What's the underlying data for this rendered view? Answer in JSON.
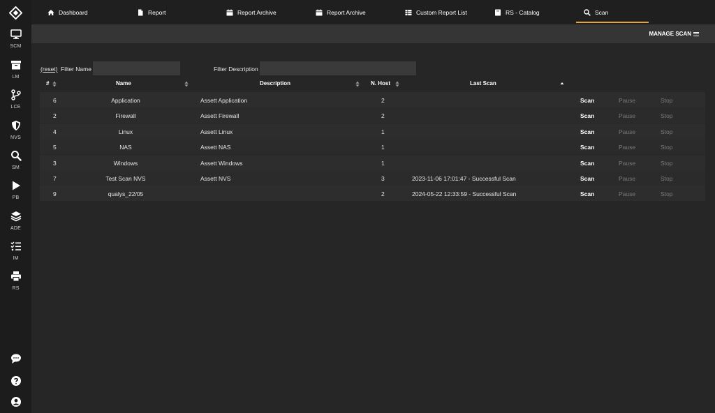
{
  "sidebar": {
    "items": [
      {
        "label": "SCM",
        "icon": "monitor-icon"
      },
      {
        "label": "LM",
        "icon": "archive-icon"
      },
      {
        "label": "LCE",
        "icon": "code-branch-icon"
      },
      {
        "label": "NVS",
        "icon": "shield-icon"
      },
      {
        "label": "SM",
        "icon": "search-icon"
      },
      {
        "label": "PB",
        "icon": "play-icon"
      },
      {
        "label": "ADE",
        "icon": "layers-icon"
      },
      {
        "label": "IM",
        "icon": "tasks-icon"
      },
      {
        "label": "RS",
        "icon": "print-icon"
      }
    ],
    "bottom": [
      "chat-icon",
      "help-icon",
      "user-icon"
    ]
  },
  "nav": {
    "tabs": [
      {
        "label": "Dashboard",
        "icon": "home-icon"
      },
      {
        "label": "Report",
        "icon": "file-icon"
      },
      {
        "label": "Report Archive",
        "icon": "calendar-icon"
      },
      {
        "label": "Report Archive",
        "icon": "calendar-icon"
      },
      {
        "label": "Custom Report List",
        "icon": "table-icon"
      },
      {
        "label": "RS - Catalog",
        "icon": "book-icon"
      },
      {
        "label": "Scan",
        "icon": "search-icon"
      }
    ],
    "active": "Scan",
    "accent": "#e8a33a"
  },
  "subbar": {
    "manage_label": "MANAGE SCAN"
  },
  "filters": {
    "reset_label": "(reset)",
    "name_label": "Filter Name",
    "name_value": "",
    "desc_label": "Filter Description",
    "desc_value": ""
  },
  "table": {
    "headers": {
      "id": "#",
      "name": "Name",
      "description": "Description",
      "hosts": "N. Host",
      "last_scan": "Last Scan"
    },
    "rows": [
      {
        "id": "6",
        "name": "Application",
        "description": "Assett Application",
        "hosts": "2",
        "last_scan": ""
      },
      {
        "id": "2",
        "name": "Firewall",
        "description": "Assett Firewall",
        "hosts": "2",
        "last_scan": ""
      },
      {
        "id": "4",
        "name": "Linux",
        "description": "Assett Linux",
        "hosts": "1",
        "last_scan": ""
      },
      {
        "id": "5",
        "name": "NAS",
        "description": "Assett NAS",
        "hosts": "1",
        "last_scan": ""
      },
      {
        "id": "3",
        "name": "Windows",
        "description": "Assett Windows",
        "hosts": "1",
        "last_scan": ""
      },
      {
        "id": "7",
        "name": "Test Scan NVS",
        "description": "Assett NVS",
        "hosts": "3",
        "last_scan": "2023-11-06 17:01:47 - Successful Scan"
      },
      {
        "id": "9",
        "name": "qualys_22/05",
        "description": "",
        "hosts": "2",
        "last_scan": "2024-05-22 12:33:59 - Successful Scan"
      }
    ],
    "actions": {
      "scan": "Scan",
      "pause": "Pause",
      "stop": "Stop"
    }
  }
}
